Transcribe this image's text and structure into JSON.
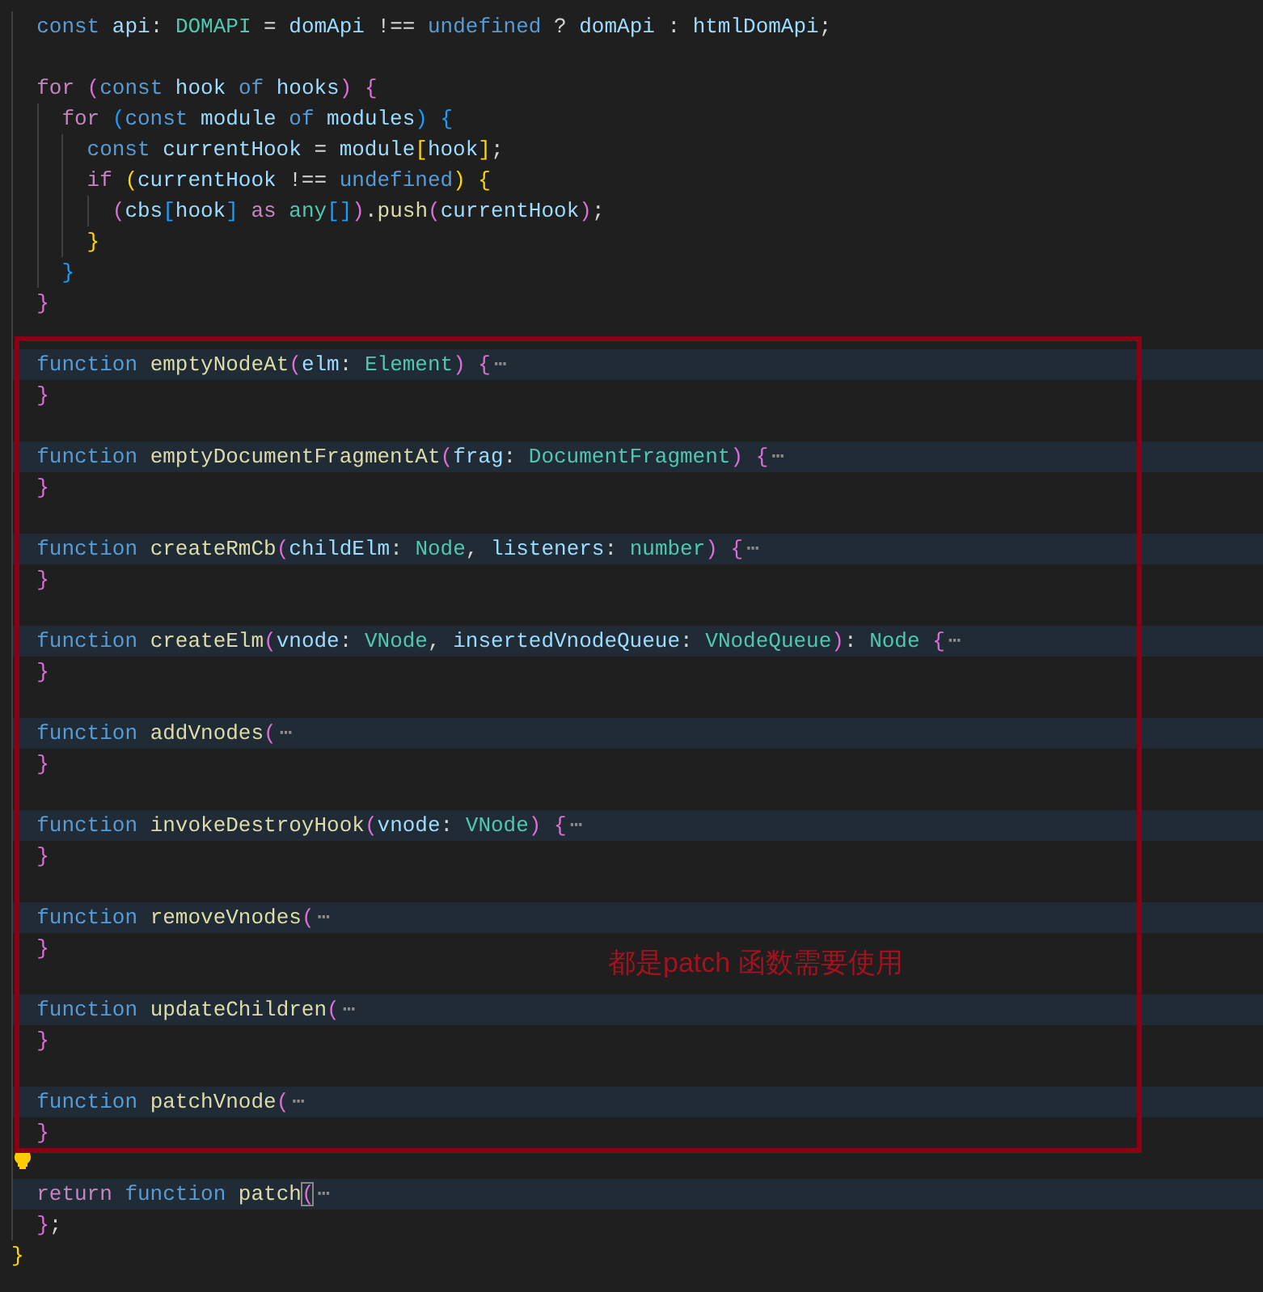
{
  "editor": {
    "lines": [
      {
        "kind": "block",
        "children": [
          {
            "kind": "code",
            "tokens": [
              {
                "text": "const",
                "kind": "kw"
              },
              {
                "text": " api",
                "kind": "var"
              },
              {
                "text": ": ",
                "kind": "punc"
              },
              {
                "text": "DOMAPI",
                "kind": "type"
              },
              {
                "text": " = ",
                "kind": "punc"
              },
              {
                "text": "domApi",
                "kind": "var"
              },
              {
                "text": " !== ",
                "kind": "punc"
              },
              {
                "text": "undefined",
                "kind": "kw"
              },
              {
                "text": " ? ",
                "kind": "punc"
              },
              {
                "text": "domApi",
                "kind": "var"
              },
              {
                "text": " : ",
                "kind": "punc"
              },
              {
                "text": "htmlDomApi",
                "kind": "var"
              },
              {
                "text": ";",
                "kind": "punc"
              }
            ]
          },
          {
            "kind": "blank"
          },
          {
            "kind": "code",
            "tokens": [
              {
                "text": "for",
                "kind": "ctl"
              },
              {
                "text": " (",
                "kind": "b2"
              },
              {
                "text": "const",
                "kind": "kw"
              },
              {
                "text": " hook ",
                "kind": "var"
              },
              {
                "text": "of",
                "kind": "kw"
              },
              {
                "text": " hooks",
                "kind": "var"
              },
              {
                "text": ") {",
                "kind": "b2"
              }
            ]
          },
          {
            "kind": "block",
            "children": [
              {
                "kind": "code",
                "tokens": [
                  {
                    "text": "for",
                    "kind": "ctl"
                  },
                  {
                    "text": " (",
                    "kind": "b3"
                  },
                  {
                    "text": "const",
                    "kind": "kw"
                  },
                  {
                    "text": " module ",
                    "kind": "var"
                  },
                  {
                    "text": "of",
                    "kind": "kw"
                  },
                  {
                    "text": " modules",
                    "kind": "var"
                  },
                  {
                    "text": ") {",
                    "kind": "b3"
                  }
                ]
              },
              {
                "kind": "block",
                "children": [
                  {
                    "kind": "code",
                    "tokens": [
                      {
                        "text": "const",
                        "kind": "kw"
                      },
                      {
                        "text": " currentHook",
                        "kind": "var"
                      },
                      {
                        "text": " = ",
                        "kind": "punc"
                      },
                      {
                        "text": "module",
                        "kind": "var"
                      },
                      {
                        "text": "[",
                        "kind": "b1"
                      },
                      {
                        "text": "hook",
                        "kind": "var"
                      },
                      {
                        "text": "]",
                        "kind": "b1"
                      },
                      {
                        "text": ";",
                        "kind": "punc"
                      }
                    ]
                  },
                  {
                    "kind": "code",
                    "tokens": [
                      {
                        "text": "if",
                        "kind": "ctl"
                      },
                      {
                        "text": " (",
                        "kind": "b1"
                      },
                      {
                        "text": "currentHook",
                        "kind": "var"
                      },
                      {
                        "text": " !== ",
                        "kind": "punc"
                      },
                      {
                        "text": "undefined",
                        "kind": "kw"
                      },
                      {
                        "text": ") {",
                        "kind": "b1"
                      }
                    ]
                  },
                  {
                    "kind": "block",
                    "children": [
                      {
                        "kind": "code",
                        "tokens": [
                          {
                            "text": "(",
                            "kind": "b2"
                          },
                          {
                            "text": "cbs",
                            "kind": "var"
                          },
                          {
                            "text": "[",
                            "kind": "b3"
                          },
                          {
                            "text": "hook",
                            "kind": "var"
                          },
                          {
                            "text": "]",
                            "kind": "b3"
                          },
                          {
                            "text": " as ",
                            "kind": "ctl"
                          },
                          {
                            "text": "any",
                            "kind": "type"
                          },
                          {
                            "text": "[]",
                            "kind": "b3"
                          },
                          {
                            "text": ")",
                            "kind": "b2"
                          },
                          {
                            "text": ".",
                            "kind": "punc"
                          },
                          {
                            "text": "push",
                            "kind": "fn"
                          },
                          {
                            "text": "(",
                            "kind": "b2"
                          },
                          {
                            "text": "currentHook",
                            "kind": "var"
                          },
                          {
                            "text": ")",
                            "kind": "b2"
                          },
                          {
                            "text": ";",
                            "kind": "punc"
                          }
                        ]
                      }
                    ]
                  },
                  {
                    "kind": "code",
                    "tokens": [
                      {
                        "text": "}",
                        "kind": "b1"
                      }
                    ]
                  }
                ]
              },
              {
                "kind": "code",
                "tokens": [
                  {
                    "text": "}",
                    "kind": "b3"
                  }
                ]
              }
            ]
          },
          {
            "kind": "code",
            "tokens": [
              {
                "text": "}",
                "kind": "b2"
              }
            ]
          },
          {
            "kind": "blank"
          },
          {
            "kind": "code",
            "folded": true,
            "tokens": [
              {
                "text": "function",
                "kind": "kw"
              },
              {
                "text": " emptyNodeAt",
                "kind": "fn"
              },
              {
                "text": "(",
                "kind": "b2"
              },
              {
                "text": "elm",
                "kind": "var"
              },
              {
                "text": ": ",
                "kind": "punc"
              },
              {
                "text": "Element",
                "kind": "type"
              },
              {
                "text": ") {",
                "kind": "b2"
              },
              {
                "text": "⋯",
                "kind": "fold"
              }
            ]
          },
          {
            "kind": "code",
            "tokens": [
              {
                "text": "}",
                "kind": "b2"
              }
            ]
          },
          {
            "kind": "blank"
          },
          {
            "kind": "code",
            "folded": true,
            "tokens": [
              {
                "text": "function",
                "kind": "kw"
              },
              {
                "text": " emptyDocumentFragmentAt",
                "kind": "fn"
              },
              {
                "text": "(",
                "kind": "b2"
              },
              {
                "text": "frag",
                "kind": "var"
              },
              {
                "text": ": ",
                "kind": "punc"
              },
              {
                "text": "DocumentFragment",
                "kind": "type"
              },
              {
                "text": ") {",
                "kind": "b2"
              },
              {
                "text": "⋯",
                "kind": "fold"
              }
            ]
          },
          {
            "kind": "code",
            "tokens": [
              {
                "text": "}",
                "kind": "b2"
              }
            ]
          },
          {
            "kind": "blank"
          },
          {
            "kind": "code",
            "folded": true,
            "tokens": [
              {
                "text": "function",
                "kind": "kw"
              },
              {
                "text": " createRmCb",
                "kind": "fn"
              },
              {
                "text": "(",
                "kind": "b2"
              },
              {
                "text": "childElm",
                "kind": "var"
              },
              {
                "text": ": ",
                "kind": "punc"
              },
              {
                "text": "Node",
                "kind": "type"
              },
              {
                "text": ", ",
                "kind": "punc"
              },
              {
                "text": "listeners",
                "kind": "var"
              },
              {
                "text": ": ",
                "kind": "punc"
              },
              {
                "text": "number",
                "kind": "type"
              },
              {
                "text": ") {",
                "kind": "b2"
              },
              {
                "text": "⋯",
                "kind": "fold"
              }
            ]
          },
          {
            "kind": "code",
            "tokens": [
              {
                "text": "}",
                "kind": "b2"
              }
            ]
          },
          {
            "kind": "blank"
          },
          {
            "kind": "code",
            "folded": true,
            "tokens": [
              {
                "text": "function",
                "kind": "kw"
              },
              {
                "text": " createElm",
                "kind": "fn"
              },
              {
                "text": "(",
                "kind": "b2"
              },
              {
                "text": "vnode",
                "kind": "var"
              },
              {
                "text": ": ",
                "kind": "punc"
              },
              {
                "text": "VNode",
                "kind": "type"
              },
              {
                "text": ", ",
                "kind": "punc"
              },
              {
                "text": "insertedVnodeQueue",
                "kind": "var"
              },
              {
                "text": ": ",
                "kind": "punc"
              },
              {
                "text": "VNodeQueue",
                "kind": "type"
              },
              {
                "text": ")",
                "kind": "b2"
              },
              {
                "text": ": ",
                "kind": "punc"
              },
              {
                "text": "Node",
                "kind": "type"
              },
              {
                "text": " {",
                "kind": "b2"
              },
              {
                "text": "⋯",
                "kind": "fold"
              }
            ]
          },
          {
            "kind": "code",
            "tokens": [
              {
                "text": "}",
                "kind": "b2"
              }
            ]
          },
          {
            "kind": "blank"
          },
          {
            "kind": "code",
            "folded": true,
            "tokens": [
              {
                "text": "function",
                "kind": "kw"
              },
              {
                "text": " addVnodes",
                "kind": "fn"
              },
              {
                "text": "(",
                "kind": "b2"
              },
              {
                "text": "⋯",
                "kind": "fold"
              }
            ]
          },
          {
            "kind": "code",
            "tokens": [
              {
                "text": "}",
                "kind": "b2"
              }
            ]
          },
          {
            "kind": "blank"
          },
          {
            "kind": "code",
            "folded": true,
            "tokens": [
              {
                "text": "function",
                "kind": "kw"
              },
              {
                "text": " invokeDestroyHook",
                "kind": "fn"
              },
              {
                "text": "(",
                "kind": "b2"
              },
              {
                "text": "vnode",
                "kind": "var"
              },
              {
                "text": ": ",
                "kind": "punc"
              },
              {
                "text": "VNode",
                "kind": "type"
              },
              {
                "text": ") {",
                "kind": "b2"
              },
              {
                "text": "⋯",
                "kind": "fold"
              }
            ]
          },
          {
            "kind": "code",
            "tokens": [
              {
                "text": "}",
                "kind": "b2"
              }
            ]
          },
          {
            "kind": "blank"
          },
          {
            "kind": "code",
            "folded": true,
            "tokens": [
              {
                "text": "function",
                "kind": "kw"
              },
              {
                "text": " removeVnodes",
                "kind": "fn"
              },
              {
                "text": "(",
                "kind": "b2"
              },
              {
                "text": "⋯",
                "kind": "fold"
              }
            ]
          },
          {
            "kind": "code",
            "tokens": [
              {
                "text": "}",
                "kind": "b2"
              }
            ]
          },
          {
            "kind": "blank"
          },
          {
            "kind": "code",
            "folded": true,
            "tokens": [
              {
                "text": "function",
                "kind": "kw"
              },
              {
                "text": " updateChildren",
                "kind": "fn"
              },
              {
                "text": "(",
                "kind": "b2"
              },
              {
                "text": "⋯",
                "kind": "fold"
              }
            ]
          },
          {
            "kind": "code",
            "tokens": [
              {
                "text": "}",
                "kind": "b2"
              }
            ]
          },
          {
            "kind": "blank"
          },
          {
            "kind": "code",
            "folded": true,
            "tokens": [
              {
                "text": "function",
                "kind": "kw"
              },
              {
                "text": " patchVnode",
                "kind": "fn"
              },
              {
                "text": "(",
                "kind": "b2"
              },
              {
                "text": "⋯",
                "kind": "fold"
              }
            ]
          },
          {
            "kind": "code",
            "tokens": [
              {
                "text": "}",
                "kind": "b2"
              }
            ]
          },
          {
            "kind": "blank",
            "lightbulb": true
          },
          {
            "kind": "code",
            "folded": true,
            "tokens": [
              {
                "text": "return",
                "kind": "ctl"
              },
              {
                "text": " function",
                "kind": "kw"
              },
              {
                "text": " patch",
                "kind": "fn"
              },
              {
                "text": "(",
                "kind": "b2",
                "matched": true
              },
              {
                "text": "⋯",
                "kind": "fold"
              }
            ]
          },
          {
            "kind": "code",
            "tokens": [
              {
                "text": "}",
                "kind": "b2"
              },
              {
                "text": ";",
                "kind": "punc"
              }
            ]
          }
        ]
      },
      {
        "kind": "code",
        "tokens": [
          {
            "text": "}",
            "kind": "b1"
          }
        ]
      }
    ]
  },
  "annotation": {
    "note": "都是patch 函数需要使用"
  }
}
